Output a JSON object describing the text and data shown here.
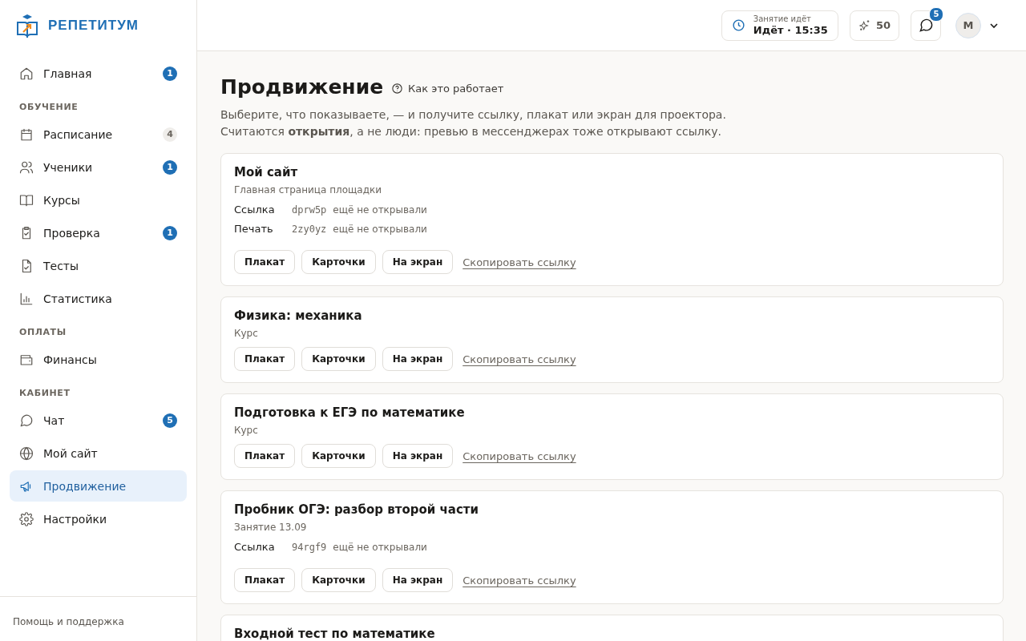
{
  "brand": {
    "name": "РЕПЕТИТУМ"
  },
  "sidebar": {
    "items": [
      {
        "kind": "link",
        "label": "Главная",
        "badge": {
          "text": "1",
          "color": "#1f6fb5"
        },
        "selected": false
      },
      {
        "kind": "section",
        "label": "ОБУЧЕНИЕ"
      },
      {
        "kind": "link",
        "label": "Расписание",
        "badge": {
          "text": "4",
          "color": "#efedea"
        },
        "selected": false
      },
      {
        "kind": "link",
        "label": "Ученики",
        "badge": {
          "text": "1",
          "color": "#1f6fb5"
        },
        "selected": false
      },
      {
        "kind": "link",
        "label": "Курсы",
        "selected": false
      },
      {
        "kind": "link",
        "label": "Проверка",
        "badge": {
          "text": "1",
          "color": "#1f6fb5"
        },
        "selected": false
      },
      {
        "kind": "link",
        "label": "Тесты",
        "selected": false
      },
      {
        "kind": "link",
        "label": "Статистика",
        "selected": false
      },
      {
        "kind": "section",
        "label": "ОПЛАТЫ"
      },
      {
        "kind": "link",
        "label": "Финансы",
        "selected": false
      },
      {
        "kind": "section",
        "label": "КАБИНЕТ"
      },
      {
        "kind": "link",
        "label": "Чат",
        "badge": {
          "text": "5",
          "color": "#1f6fb5"
        },
        "selected": false
      },
      {
        "kind": "link",
        "label": "Мой сайт",
        "selected": false
      },
      {
        "kind": "link",
        "label": "Продвижение",
        "selected": true
      },
      {
        "kind": "link",
        "label": "Настройки",
        "selected": false
      }
    ],
    "footer": "Помощь и поддержка"
  },
  "topbar": {
    "lesson": {
      "caption": "Занятие идёт",
      "value": "Идёт · 15:35"
    },
    "points": "50",
    "chat_badge": "5",
    "avatar": "М"
  },
  "page": {
    "title": "Продвижение",
    "help_link": "Как это работает",
    "description": [
      "Выберите, что показываете, — и получите ссылку, плакат или экран для проектора.",
      "Считаются **открытия**, а не люди: превью в мессенджерах тоже открывают ссылку."
    ]
  },
  "cards": [
    {
      "title": "Мой сайт",
      "subtitle": "Главная страница площадки",
      "links": [
        {
          "label": "Ссылка",
          "code": "dprw5p",
          "status": "ещё не открывали"
        },
        {
          "label": "Печать",
          "code": "2zy0yz",
          "status": "ещё не открывали"
        }
      ],
      "buttons": [
        "Плакат",
        "Карточки",
        "На экран"
      ],
      "copy_link": "Скопировать ссылку"
    },
    {
      "title": "Физика: механика",
      "subtitle": "Курс",
      "buttons": [
        "Плакат",
        "Карточки",
        "На экран"
      ],
      "copy_link": "Скопировать ссылку"
    },
    {
      "title": "Подготовка к ЕГЭ по математике",
      "subtitle": "Курс",
      "buttons": [
        "Плакат",
        "Карточки",
        "На экран"
      ],
      "copy_link": "Скопировать ссылку"
    },
    {
      "title": "Пробник ОГЭ: разбор второй части",
      "subtitle": "Занятие 13.09",
      "links": [
        {
          "label": "Ссылка",
          "code": "94rgf9",
          "status": "ещё не открывали"
        }
      ],
      "buttons": [
        "Плакат",
        "Карточки",
        "На экран"
      ],
      "copy_link": "Скопировать ссылку"
    },
    {
      "title": "Входной тест по математике"
    }
  ]
}
